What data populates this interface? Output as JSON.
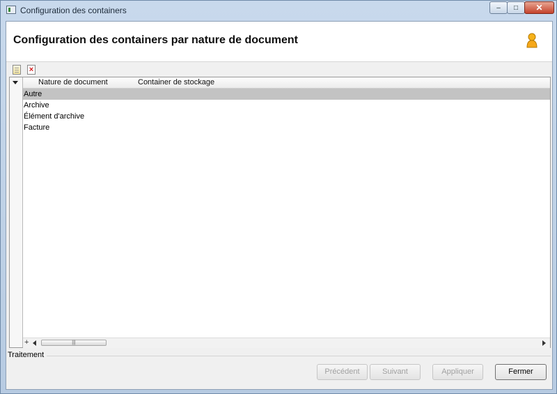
{
  "window": {
    "title": "Configuration des containers",
    "minimize_glyph": "–",
    "maximize_glyph": "□",
    "close_glyph": "✕"
  },
  "header": {
    "title": "Configuration des containers par nature de document",
    "user_icon": "user-icon"
  },
  "toolbar": {
    "new_icon": "new-document-icon",
    "delete_icon": "delete-document-icon",
    "delete_glyph": "×"
  },
  "grid": {
    "columns": [
      "Nature de document",
      "Container de stockage"
    ],
    "rows": [
      {
        "nature": "Autre",
        "container": "",
        "selected": true
      },
      {
        "nature": "Archive",
        "container": "",
        "selected": false
      },
      {
        "nature": "Élément d'archive",
        "container": "",
        "selected": false
      },
      {
        "nature": "Facture",
        "container": "",
        "selected": false
      }
    ],
    "hscroll_plus": "+",
    "hscroll_thumb_grip": "|||"
  },
  "footer": {
    "section_label": "Traitement",
    "buttons": {
      "previous": "Précédent",
      "next": "Suivant",
      "apply": "Appliquer",
      "close": "Fermer"
    }
  },
  "colors": {
    "selected_row": "#c3c3c3",
    "title_bar": "#c8d9ec",
    "close_button": "#c5432c"
  }
}
